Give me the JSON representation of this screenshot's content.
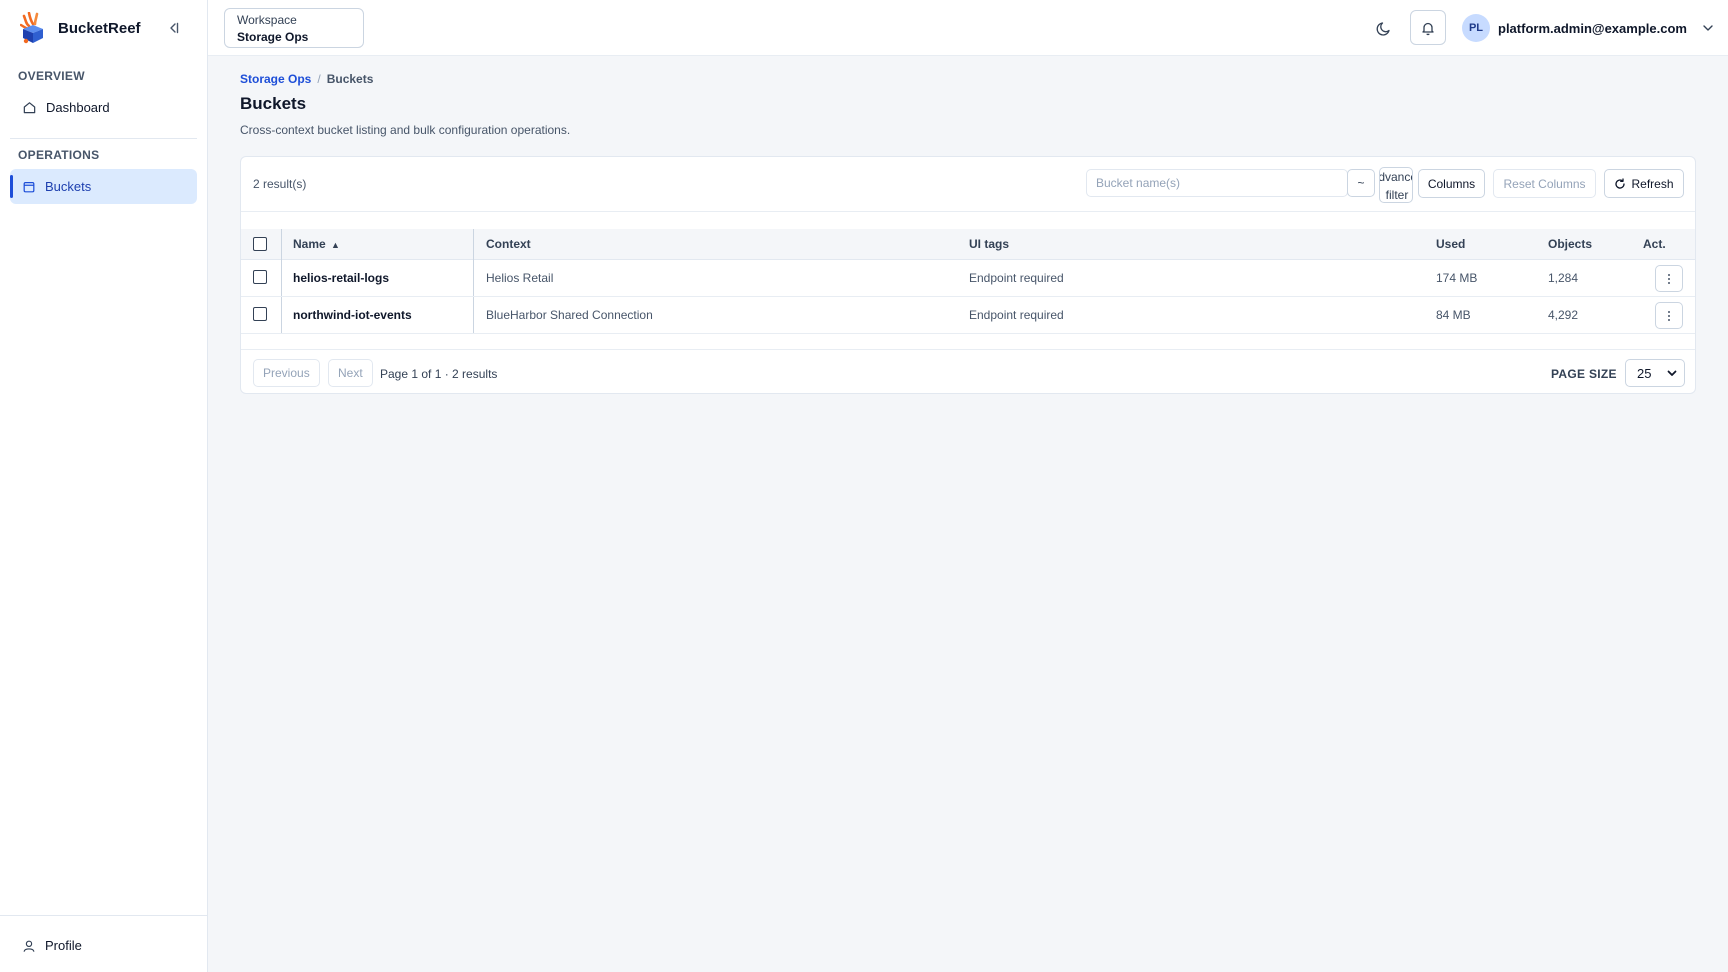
{
  "app": {
    "name": "BucketReef"
  },
  "sidebar": {
    "sections": [
      {
        "label": "OVERVIEW",
        "items": [
          {
            "label": "Dashboard",
            "icon": "home-icon"
          }
        ]
      },
      {
        "label": "OPERATIONS",
        "items": [
          {
            "label": "Buckets",
            "icon": "bucket-icon",
            "active": true
          }
        ]
      }
    ],
    "footer": {
      "label": "Profile",
      "icon": "user-icon"
    }
  },
  "topbar": {
    "workspace": {
      "label": "Workspace",
      "value": "Storage Ops"
    },
    "user": {
      "initials": "PL",
      "email": "platform.admin@example.com"
    }
  },
  "breadcrumb": {
    "parent": "Storage Ops",
    "current": "Buckets"
  },
  "page": {
    "title": "Buckets",
    "description": "Cross-context bucket listing and bulk configuration operations."
  },
  "toolbar": {
    "result_count": "2 result(s)",
    "search_placeholder": "Bucket name(s)",
    "tilde_label": "~",
    "advanced_filter_line1": "Advanced",
    "advanced_filter_line2": "filter",
    "columns_label": "Columns",
    "reset_columns_label": "Reset Columns",
    "refresh_label": "Refresh"
  },
  "table": {
    "columns": {
      "name": "Name",
      "context": "Context",
      "ui_tags": "UI tags",
      "used": "Used",
      "objects": "Objects",
      "actions": "Act."
    },
    "sort_indicator": "▲",
    "rows": [
      {
        "name": "helios-retail-logs",
        "context": "Helios Retail",
        "ui_tags": "Endpoint required",
        "used": "174 MB",
        "objects": "1,284"
      },
      {
        "name": "northwind-iot-events",
        "context": "BlueHarbor Shared Connection",
        "ui_tags": "Endpoint required",
        "used": "84 MB",
        "objects": "4,292"
      }
    ]
  },
  "pagination": {
    "previous_label": "Previous",
    "next_label": "Next",
    "info": "Page 1 of 1 · 2 results",
    "page_size_label": "PAGE SIZE",
    "page_size_value": "25"
  },
  "colors": {
    "accent": "#1d4ed8",
    "active_nav_bg": "#dbeafe",
    "page_bg": "#f4f6f9",
    "logo_orange": "#f26a21"
  }
}
